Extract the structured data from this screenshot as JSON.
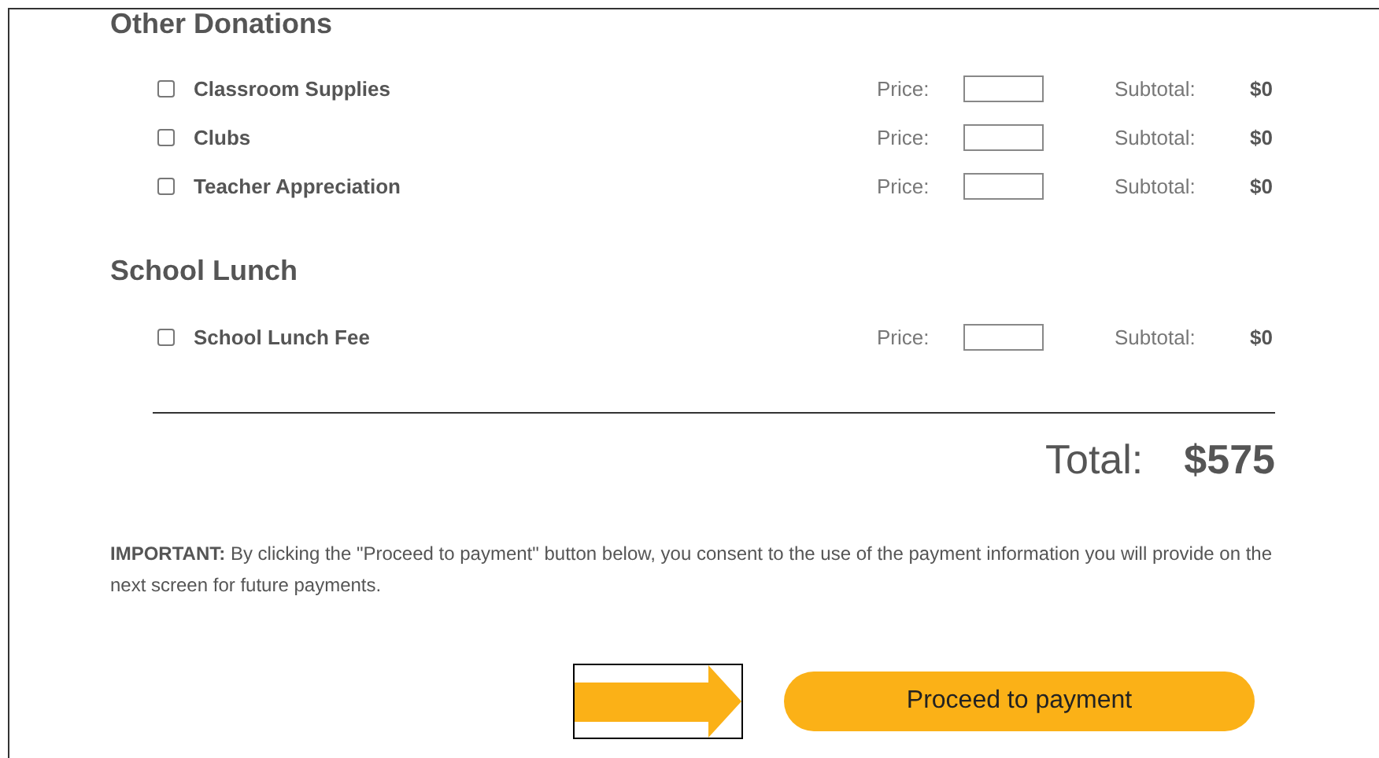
{
  "sections": [
    {
      "title": "Other Donations",
      "items": [
        {
          "label": "Classroom Supplies",
          "checked": false,
          "price_label": "Price:",
          "subtotal_label": "Subtotal:",
          "subtotal": "$0"
        },
        {
          "label": "Clubs",
          "checked": false,
          "price_label": "Price:",
          "subtotal_label": "Subtotal:",
          "subtotal": "$0"
        },
        {
          "label": "Teacher Appreciation",
          "checked": false,
          "price_label": "Price:",
          "subtotal_label": "Subtotal:",
          "subtotal": "$0"
        }
      ]
    },
    {
      "title": "School Lunch",
      "items": [
        {
          "label": "School Lunch Fee",
          "checked": false,
          "price_label": "Price:",
          "subtotal_label": "Subtotal:",
          "subtotal": "$0"
        }
      ]
    }
  ],
  "total": {
    "label": "Total:",
    "value": "$575"
  },
  "notice": "**IMPORTANT:** By clicking the \"Proceed to payment\" button below, you consent to the use of the payment information you will provide on the next screen for future payments.",
  "button": "Proceed to payment"
}
